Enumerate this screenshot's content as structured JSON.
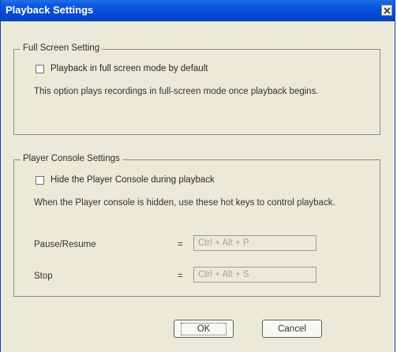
{
  "window": {
    "title": "Playback Settings",
    "accent_color": "#0a57e0",
    "close_icon": "close-icon"
  },
  "full_screen": {
    "legend": "Full Screen Setting",
    "checkbox_label": "Playback in full screen mode by default",
    "checked": false,
    "description": "This option plays recordings in full-screen mode once playback begins."
  },
  "console": {
    "legend": "Player Console Settings",
    "checkbox_label": "Hide the Player Console during playback",
    "checked": false,
    "description": "When the Player console is hidden, use these hot keys to control playback.",
    "hotkeys": [
      {
        "label": "Pause/Resume",
        "equals": "=",
        "value": "Ctrl + Alt + P"
      },
      {
        "label": "Stop",
        "equals": "=",
        "value": "Ctrl + Alt + S"
      }
    ]
  },
  "buttons": {
    "ok": "OK",
    "cancel": "Cancel"
  }
}
